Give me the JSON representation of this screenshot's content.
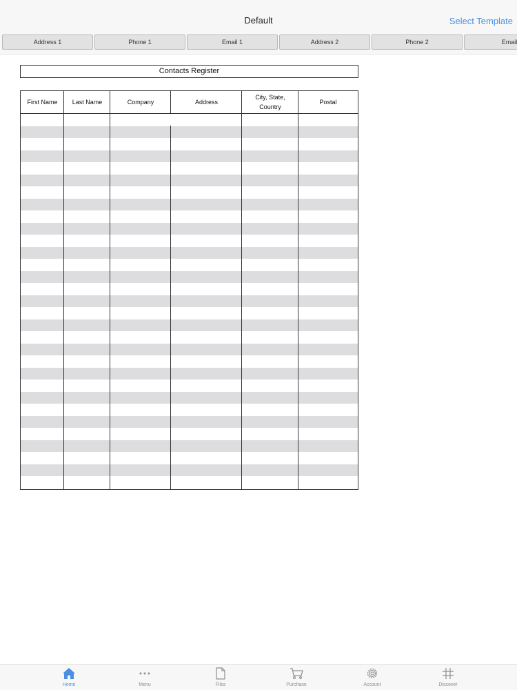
{
  "navbar": {
    "title": "Default",
    "action_label": "Select Template"
  },
  "field_chips": [
    "Address 1",
    "Phone 1",
    "Email 1",
    "Address 2",
    "Phone 2",
    "Email"
  ],
  "document": {
    "title": "Contacts Register",
    "columns": [
      "First Name",
      "Last Name",
      "Company",
      "Address",
      "City, State,\nCountry",
      "Postal"
    ],
    "row_count": 31
  },
  "tabbar": {
    "active": "Home",
    "tabs": [
      {
        "label": "Home",
        "icon": "house-icon"
      },
      {
        "label": "Menu",
        "icon": "ellipsis-icon"
      },
      {
        "label": "Files",
        "icon": "document-icon"
      },
      {
        "label": "Purchase",
        "icon": "cart-icon"
      },
      {
        "label": "Account",
        "icon": "gear-icon"
      },
      {
        "label": "Discover",
        "icon": "hash-icon"
      }
    ]
  },
  "colors": {
    "accent": "#4a90e2",
    "row_shade": "#dddde0",
    "chip_bg": "#e2e2e2"
  }
}
